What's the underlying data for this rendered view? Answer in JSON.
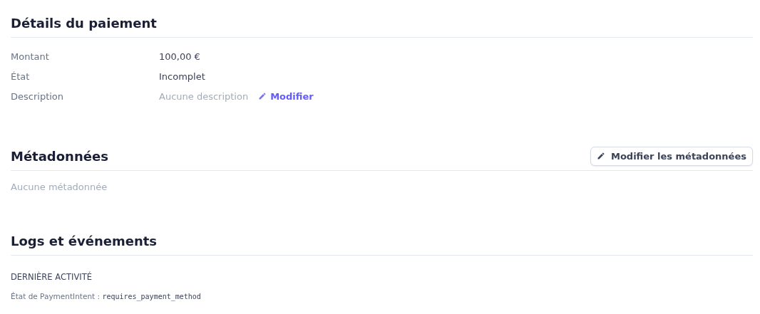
{
  "payment_details": {
    "title": "Détails du paiement",
    "rows": [
      {
        "label": "Montant",
        "value": "100,00 €",
        "empty": false
      },
      {
        "label": "État",
        "value": "Incomplet",
        "empty": false
      },
      {
        "label": "Description",
        "value": "Aucune description",
        "empty": true,
        "action": "Modifier"
      }
    ]
  },
  "metadata": {
    "title": "Métadonnées",
    "button": "Modifier les métadonnées",
    "empty_text": "Aucune métadonnée"
  },
  "logs": {
    "title": "Logs et événements",
    "subtitle": "DERNIÈRE ACTIVITÉ",
    "entry_label": "État de PaymentIntent :",
    "entry_value": "requires_payment_method"
  }
}
